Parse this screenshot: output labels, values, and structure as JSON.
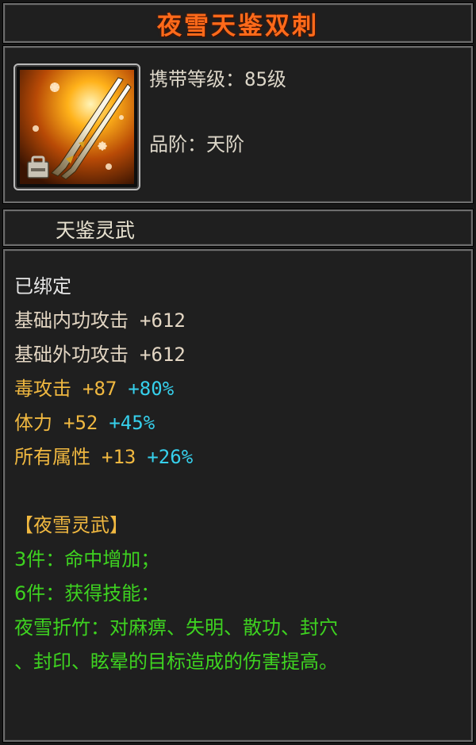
{
  "item": {
    "name": "夜雪天鉴双刺",
    "level_label": "携带等级：",
    "level_value": "85级",
    "grade_label": "品阶：",
    "grade_value": "天阶",
    "category": "天鉴灵武",
    "icon": "twin-spears-icon"
  },
  "status": {
    "bound": "已绑定"
  },
  "base_stats": [
    {
      "label": "基础内功攻击",
      "value": "+612"
    },
    {
      "label": "基础外功攻击",
      "value": "+612"
    }
  ],
  "bonus_stats": [
    {
      "label": "毒攻击",
      "value": "+87",
      "percent": "+80%"
    },
    {
      "label": "体力",
      "value": "+52",
      "percent": "+45%"
    },
    {
      "label": "所有属性",
      "value": "+13",
      "percent": "+26%"
    }
  ],
  "set": {
    "title": "【夜雪灵武】",
    "bonus_3": "3件：命中增加；",
    "bonus_6": "6件：获得技能：",
    "skill_line1": "夜雪折竹：对麻痹、失明、散功、封穴",
    "skill_line2": "、封印、眩晕的目标造成的伤害提高。"
  },
  "colors": {
    "title": "#ff6a1a",
    "bonus_label": "#f0b840",
    "bonus_percent": "#36d0ec",
    "set_text": "#3ed320",
    "base_stat": "#e3d6c3"
  }
}
